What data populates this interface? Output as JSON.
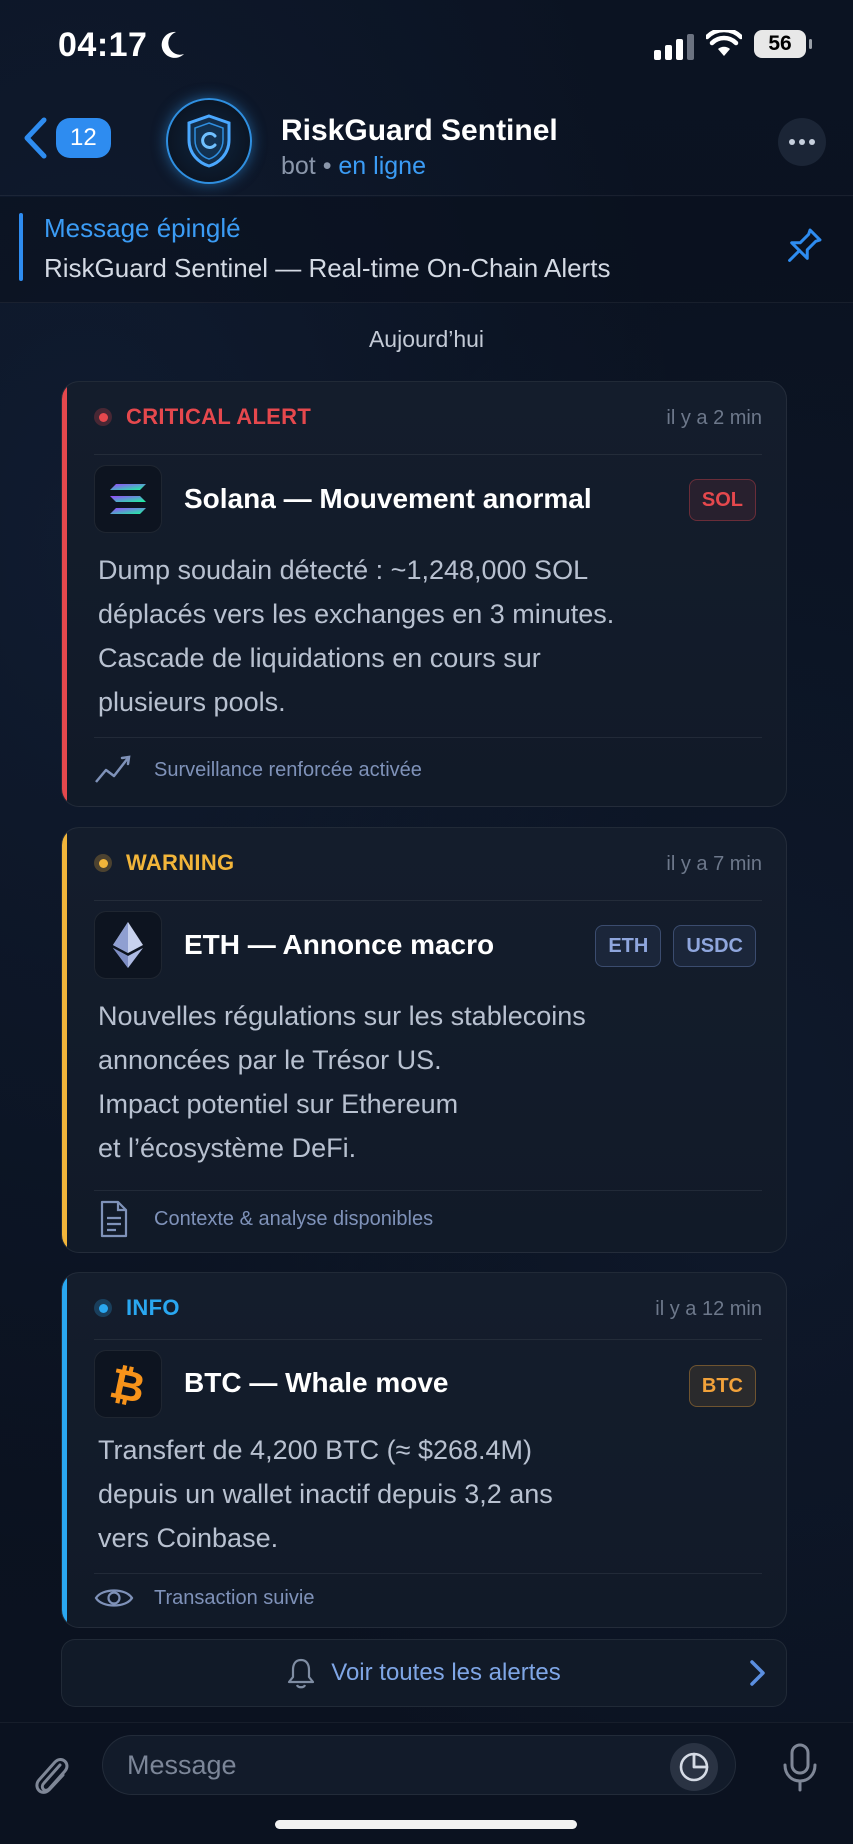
{
  "status_bar": {
    "time": "04:17",
    "battery": "56"
  },
  "header": {
    "back_count": "12",
    "title": "RiskGuard Sentinel",
    "subtitle_prefix": "bot •",
    "subtitle_status": "en ligne"
  },
  "pinned": {
    "label": "Message épinglé",
    "text": "RiskGuard Sentinel — Real-time On-Chain Alerts"
  },
  "day_label": "Aujourd’hui",
  "alerts": [
    {
      "level": "CRITICAL ALERT",
      "color": "#e5484d",
      "time": "il y a 2 min",
      "coin_icon": "solana-icon",
      "title": "Solana — Mouvement anormal",
      "tags": [
        "SOL"
      ],
      "body": [
        "Dump soudain détecté : ~1,248,000 SOL",
        "déplacés vers les exchanges en 3 minutes.",
        "Cascade de liquidations en cours sur",
        "plusieurs pools."
      ],
      "footer_icon": "trend-icon",
      "footer": "Surveillance renforcée activée"
    },
    {
      "level": "WARNING",
      "color": "#f2b53a",
      "time": "il y a 7 min",
      "coin_icon": "ethereum-icon",
      "title": "ETH — Annonce macro",
      "tags": [
        "ETH",
        "USDC"
      ],
      "body": [
        "Nouvelles régulations sur les stablecoins",
        "annoncées par le Trésor US.",
        "Impact potentiel sur Ethereum",
        "et l’écosystème DeFi."
      ],
      "footer_icon": "document-icon",
      "footer": "Contexte & analyse disponibles"
    },
    {
      "level": "INFO",
      "color": "#2aa7f0",
      "time": "il y a 12 min",
      "coin_icon": "bitcoin-icon",
      "title": "BTC — Whale move",
      "tags": [
        "BTC"
      ],
      "body": [
        "Transfert de 4,200 BTC (≈ $268.4M)",
        "depuis un wallet inactif depuis 3,2 ans",
        "vers Coinbase."
      ],
      "footer_icon": "eye-icon",
      "footer": "Transaction suivie"
    }
  ],
  "see_all": "Voir toutes les alertes",
  "composer": {
    "placeholder": "Message"
  }
}
